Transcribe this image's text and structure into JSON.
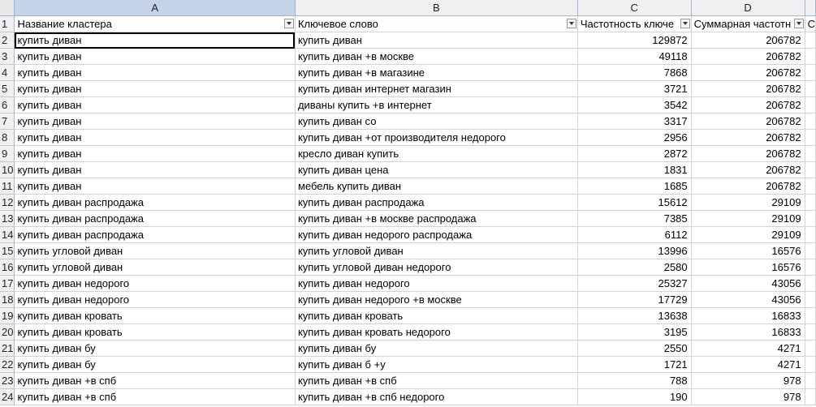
{
  "columns": [
    "A",
    "B",
    "C",
    "D"
  ],
  "header_row": {
    "row_number": "1",
    "cells": [
      "Название кластера",
      "Ключевое слово",
      "Частотность ключе",
      "Суммарная частотн",
      "C"
    ]
  },
  "rows": [
    {
      "n": "2",
      "cluster": "купить диван",
      "keyword": "купить диван",
      "freq": "129872",
      "sum": "206782"
    },
    {
      "n": "3",
      "cluster": "купить диван",
      "keyword": "купить диван +в москве",
      "freq": "49118",
      "sum": "206782"
    },
    {
      "n": "4",
      "cluster": "купить диван",
      "keyword": "купить диван +в магазине",
      "freq": "7868",
      "sum": "206782"
    },
    {
      "n": "5",
      "cluster": "купить диван",
      "keyword": "купить диван интернет магазин",
      "freq": "3721",
      "sum": "206782"
    },
    {
      "n": "6",
      "cluster": "купить диван",
      "keyword": "диваны купить +в интернет",
      "freq": "3542",
      "sum": "206782"
    },
    {
      "n": "7",
      "cluster": "купить диван",
      "keyword": "купить диван со",
      "freq": "3317",
      "sum": "206782"
    },
    {
      "n": "8",
      "cluster": "купить диван",
      "keyword": "купить диван +от производителя недорого",
      "freq": "2956",
      "sum": "206782"
    },
    {
      "n": "9",
      "cluster": "купить диван",
      "keyword": "кресло диван купить",
      "freq": "2872",
      "sum": "206782"
    },
    {
      "n": "10",
      "cluster": "купить диван",
      "keyword": "купить диван цена",
      "freq": "1831",
      "sum": "206782"
    },
    {
      "n": "11",
      "cluster": "купить диван",
      "keyword": "мебель купить диван",
      "freq": "1685",
      "sum": "206782"
    },
    {
      "n": "12",
      "cluster": "купить диван распродажа",
      "keyword": "купить диван распродажа",
      "freq": "15612",
      "sum": "29109"
    },
    {
      "n": "13",
      "cluster": "купить диван распродажа",
      "keyword": "купить диван +в москве распродажа",
      "freq": "7385",
      "sum": "29109"
    },
    {
      "n": "14",
      "cluster": "купить диван распродажа",
      "keyword": "купить диван недорого распродажа",
      "freq": "6112",
      "sum": "29109"
    },
    {
      "n": "15",
      "cluster": "купить угловой диван",
      "keyword": "купить угловой диван",
      "freq": "13996",
      "sum": "16576"
    },
    {
      "n": "16",
      "cluster": "купить угловой диван",
      "keyword": "купить угловой диван недорого",
      "freq": "2580",
      "sum": "16576"
    },
    {
      "n": "17",
      "cluster": "купить диван недорого",
      "keyword": "купить диван недорого",
      "freq": "25327",
      "sum": "43056"
    },
    {
      "n": "18",
      "cluster": "купить диван недорого",
      "keyword": "купить диван недорого +в москве",
      "freq": "17729",
      "sum": "43056"
    },
    {
      "n": "19",
      "cluster": "купить диван кровать",
      "keyword": "купить диван кровать",
      "freq": "13638",
      "sum": "16833"
    },
    {
      "n": "20",
      "cluster": "купить диван кровать",
      "keyword": "купить диван кровать недорого",
      "freq": "3195",
      "sum": "16833"
    },
    {
      "n": "21",
      "cluster": "купить диван бу",
      "keyword": "купить диван бу",
      "freq": "2550",
      "sum": "4271"
    },
    {
      "n": "22",
      "cluster": "купить диван бу",
      "keyword": "купить диван б +у",
      "freq": "1721",
      "sum": "4271"
    },
    {
      "n": "23",
      "cluster": "купить диван +в спб",
      "keyword": "купить диван +в спб",
      "freq": "788",
      "sum": "978"
    },
    {
      "n": "24",
      "cluster": "купить диван +в спб",
      "keyword": "купить диван +в спб недорого",
      "freq": "190",
      "sum": "978"
    }
  ]
}
